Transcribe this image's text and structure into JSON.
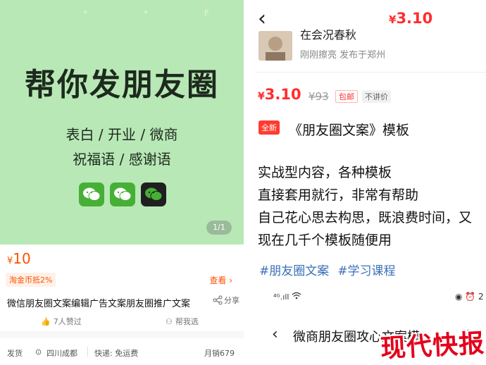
{
  "left": {
    "hero": {
      "status_left": "*",
      "status_mid": "*",
      "status_right": "F",
      "title": "帮你发朋友圈",
      "subtitle_1": "表白 / 开业 / 微商",
      "subtitle_2": "祝福语 / 感谢语",
      "wechat_icons": [
        "wechat-icon",
        "wechat-icon",
        "wechat-icon"
      ],
      "page_indicator": "1/1"
    },
    "price": {
      "currency": "¥",
      "amount": "10",
      "coin_note": "淘金币抵2%",
      "view_more": "查看 ›"
    },
    "item": {
      "title": "微信朋友圈文案编辑广告文案朋友圈推广文案",
      "share_label": "分享",
      "likes_label": "7人赞过",
      "help_pick_label": "帮我选"
    },
    "shipping": {
      "ship_label": "发货",
      "location": "四川成都",
      "delivery": "快递: 免运费",
      "monthly_sales": "月销679"
    }
  },
  "right": {
    "top_price": {
      "currency": "¥",
      "amount": "3.10"
    },
    "seller": {
      "name": "在会况春秋",
      "meta": "刚刚擦亮  发布于郑州"
    },
    "price": {
      "currency": "¥",
      "amount": "3.10",
      "original": "¥93",
      "tag_shipping": "包邮",
      "tag_no_bargain": "不讲价"
    },
    "post": {
      "badge": "全新",
      "title": "《朋友圈文案》模板",
      "desc_lines": [
        "实战型内容，各种模板",
        "直接套用就行，非常有帮助",
        "自己花心思去构思，既浪费时间，又",
        "现在几千个模板随便用"
      ],
      "hashtags": [
        "#朋友圈文案",
        "#学习课程"
      ]
    },
    "phone_status": {
      "signal": "⁴ᴳ.ıll",
      "right": "◉ ⏰ 2"
    },
    "sub_nav": {
      "back": "‹",
      "title": "微商朋友圈攻心文案模...",
      "plus": "+"
    }
  },
  "watermark": "现代快报",
  "colors": {
    "hero_bg": "#b9e8b7",
    "price_orange": "#ff5000",
    "price_red": "#ff2d2d",
    "hashtag_blue": "#3a6fb7",
    "wechat_green": "#45b035",
    "watermark_red": "#e4001b"
  }
}
